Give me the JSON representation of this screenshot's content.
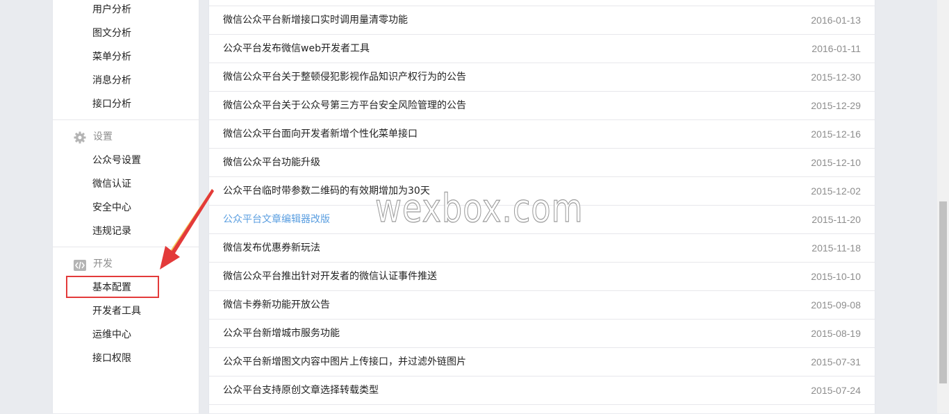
{
  "sidebar": {
    "analysis_items": [
      "用户分析",
      "图文分析",
      "菜单分析",
      "消息分析",
      "接口分析"
    ],
    "settings": {
      "title": "设置",
      "icon": "gear-icon",
      "items": [
        "公众号设置",
        "微信认证",
        "安全中心",
        "违规记录"
      ]
    },
    "develop": {
      "title": "开发",
      "icon": "code-icon",
      "items": [
        "基本配置",
        "开发者工具",
        "运维中心",
        "接口权限"
      ],
      "highlighted_item": "基本配置"
    }
  },
  "news": [
    {
      "title": "微信公众平台新增接口实时调用量清零功能",
      "date": "2016-01-13"
    },
    {
      "title": "公众平台发布微信web开发者工具",
      "date": "2016-01-11"
    },
    {
      "title": "微信公众平台关于整顿侵犯影视作品知识产权行为的公告",
      "date": "2015-12-30"
    },
    {
      "title": "微信公众平台关于公众号第三方平台安全风险管理的公告",
      "date": "2015-12-29"
    },
    {
      "title": "微信公众平台面向开发者新增个性化菜单接口",
      "date": "2015-12-16"
    },
    {
      "title": "微信公众平台功能升级",
      "date": "2015-12-10"
    },
    {
      "title": "公众平台临时带参数二维码的有效期增加为30天",
      "date": "2015-12-02"
    },
    {
      "title": "公众平台文章编辑器改版",
      "date": "2015-11-20",
      "link": true
    },
    {
      "title": "微信发布优惠券新玩法",
      "date": "2015-11-18"
    },
    {
      "title": "微信公众平台推出针对开发者的微信认证事件推送",
      "date": "2015-10-10"
    },
    {
      "title": "微信卡券新功能开放公告",
      "date": "2015-09-08"
    },
    {
      "title": "公众平台新增城市服务功能",
      "date": "2015-08-19"
    },
    {
      "title": "公众平台新增图文内容中图片上传接口，并过滤外链图片",
      "date": "2015-07-31"
    },
    {
      "title": "公众平台支持原创文章选择转载类型",
      "date": "2015-07-24"
    }
  ],
  "watermark": "wexbox.com",
  "colors": {
    "link": "#5a9ee0",
    "highlight": "#e33a3a",
    "arrow": "#e33a3a"
  }
}
